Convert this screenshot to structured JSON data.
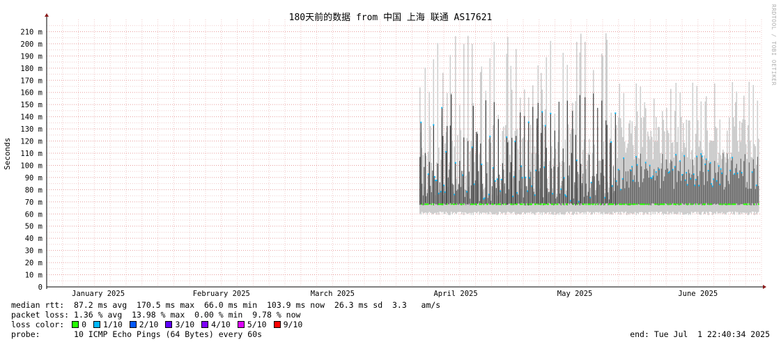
{
  "header": {
    "title": "180天前的数据 from 中国 上海 联通 AS17621",
    "watermark": "RRDTOOL / TOBI OETIKER"
  },
  "axis": {
    "ylabel": "Seconds"
  },
  "legend": {
    "median_label": "median rtt:",
    "median_text": "87.2 ms avg  170.5 ms max  66.0 ms min  103.9 ms now  26.3 ms sd  3.3   am/s",
    "loss_label": "packet loss:",
    "loss_text": "1.36 % avg  13.98 % max  0.00 % min  9.78 % now",
    "color_label": "loss color:",
    "colors": [
      {
        "label": "0",
        "color": "#26ff00"
      },
      {
        "label": "1/10",
        "color": "#00b8ff"
      },
      {
        "label": "2/10",
        "color": "#0059ff"
      },
      {
        "label": "3/10",
        "color": "#5e00ff"
      },
      {
        "label": "4/10",
        "color": "#7e00ff"
      },
      {
        "label": "5/10",
        "color": "#dd00ff"
      },
      {
        "label": "9/10",
        "color": "#ff0000"
      }
    ],
    "probe_label": "probe:",
    "probe_text": "10 ICMP Echo Pings (64 Bytes) every 60s",
    "end_text": "end: Tue Jul  1 22:40:34 2025"
  },
  "chart_data": {
    "type": "area",
    "title": "180天前的数据 from 中国 上海 联通 AS17621",
    "ylabel": "Seconds",
    "xlabel": "",
    "y_ticks": [
      "0",
      "10 m",
      "20 m",
      "30 m",
      "40 m",
      "50 m",
      "60 m",
      "70 m",
      "80 m",
      "90 m",
      "100 m",
      "110 m",
      "120 m",
      "130 m",
      "140 m",
      "150 m",
      "160 m",
      "170 m",
      "180 m",
      "190 m",
      "200 m",
      "210 m"
    ],
    "ylim_ms": [
      0,
      220
    ],
    "x_ticks": [
      {
        "label": "January 2025",
        "x": "2025-01-15"
      },
      {
        "label": "February 2025",
        "x": "2025-02-15"
      },
      {
        "label": "March 2025",
        "x": "2025-03-15"
      },
      {
        "label": "April 2025",
        "x": "2025-04-15"
      },
      {
        "label": "May 2025",
        "x": "2025-05-15"
      },
      {
        "label": "June 2025",
        "x": "2025-06-15"
      }
    ],
    "xlim": [
      "2025-01-02",
      "2025-07-01"
    ],
    "data_start": "2025-04-06",
    "grid": true,
    "series": [
      {
        "name": "median rtt",
        "avg": 87.2,
        "max": 170.5,
        "min": 66.0,
        "now": 103.9
      },
      {
        "name": "packet loss",
        "avg": 1.36,
        "max": 13.98,
        "min": 0.0,
        "now": 9.78
      }
    ]
  }
}
